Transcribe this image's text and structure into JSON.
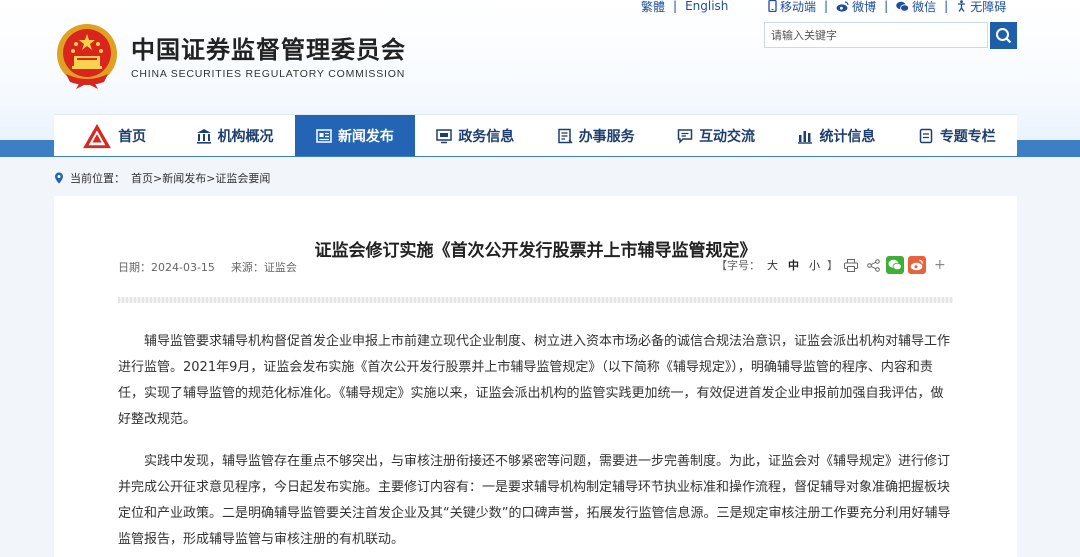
{
  "top_links": {
    "traditional": "繁體",
    "english": "English",
    "mobile": "移动端",
    "weibo": "微博",
    "wechat": "微信",
    "accessibility": "无障碍"
  },
  "site": {
    "title": "中国证券监督管理委员会",
    "subtitle": "CHINA SECURITIES REGULATORY COMMISSION"
  },
  "search": {
    "placeholder": "请输入关键字"
  },
  "nav": {
    "items": [
      {
        "label": "首页",
        "icon": "home-logo-icon"
      },
      {
        "label": "机构概况",
        "icon": "building-icon"
      },
      {
        "label": "新闻发布",
        "icon": "news-icon"
      },
      {
        "label": "政务信息",
        "icon": "monitor-icon"
      },
      {
        "label": "办事服务",
        "icon": "service-icon"
      },
      {
        "label": "互动交流",
        "icon": "chat-icon"
      },
      {
        "label": "统计信息",
        "icon": "stats-icon"
      },
      {
        "label": "专题专栏",
        "icon": "topic-icon"
      }
    ],
    "active_index": 2
  },
  "breadcrumb": {
    "prefix": "当前位置：",
    "path": "首页>新闻发布>证监会要闻"
  },
  "article": {
    "title": "证监会修订实施《首次公开发行股票并上市辅导监管规定》",
    "date": "日期：2024-03-15",
    "source": "来源：证监会",
    "font_label": "【字号：",
    "size_large": "大",
    "size_medium": "中",
    "size_small": "小",
    "bracket_close": "】",
    "more": "+",
    "paragraphs": [
      "辅导监管要求辅导机构督促首发企业申报上市前建立现代企业制度、树立进入资本市场必备的诚信合规法治意识，证监会派出机构对辅导工作进行监管。2021年9月，证监会发布实施《首次公开发行股票并上市辅导监管规定》（以下简称《辅导规定》），明确辅导监管的程序、内容和责任，实现了辅导监管的规范化标准化。《辅导规定》实施以来，证监会派出机构的监管实践更加统一，有效促进首发企业申报前加强自我评估，做好整改规范。",
      "实践中发现，辅导监管存在重点不够突出，与审核注册衔接还不够紧密等问题，需要进一步完善制度。为此，证监会对《辅导规定》进行修订并完成公开征求意见程序，今日起发布实施。主要修订内容有：一是要求辅导机构制定辅导环节执业标准和操作流程，督促辅导对象准确把握板块定位和产业政策。二是明确辅导监管要关注首发企业及其“关键少数”的口碑声誉，拓展发行监管信息源。三是规定审核注册工作要充分利用好辅导监管报告，形成辅导监管与审核注册的有机联动。"
    ]
  },
  "colors": {
    "primary": "#2365b4",
    "stripe": "#3d7fc4",
    "nav_text": "#1e3e6d",
    "wechat": "#3cb034",
    "weibo": "#e8623a"
  }
}
